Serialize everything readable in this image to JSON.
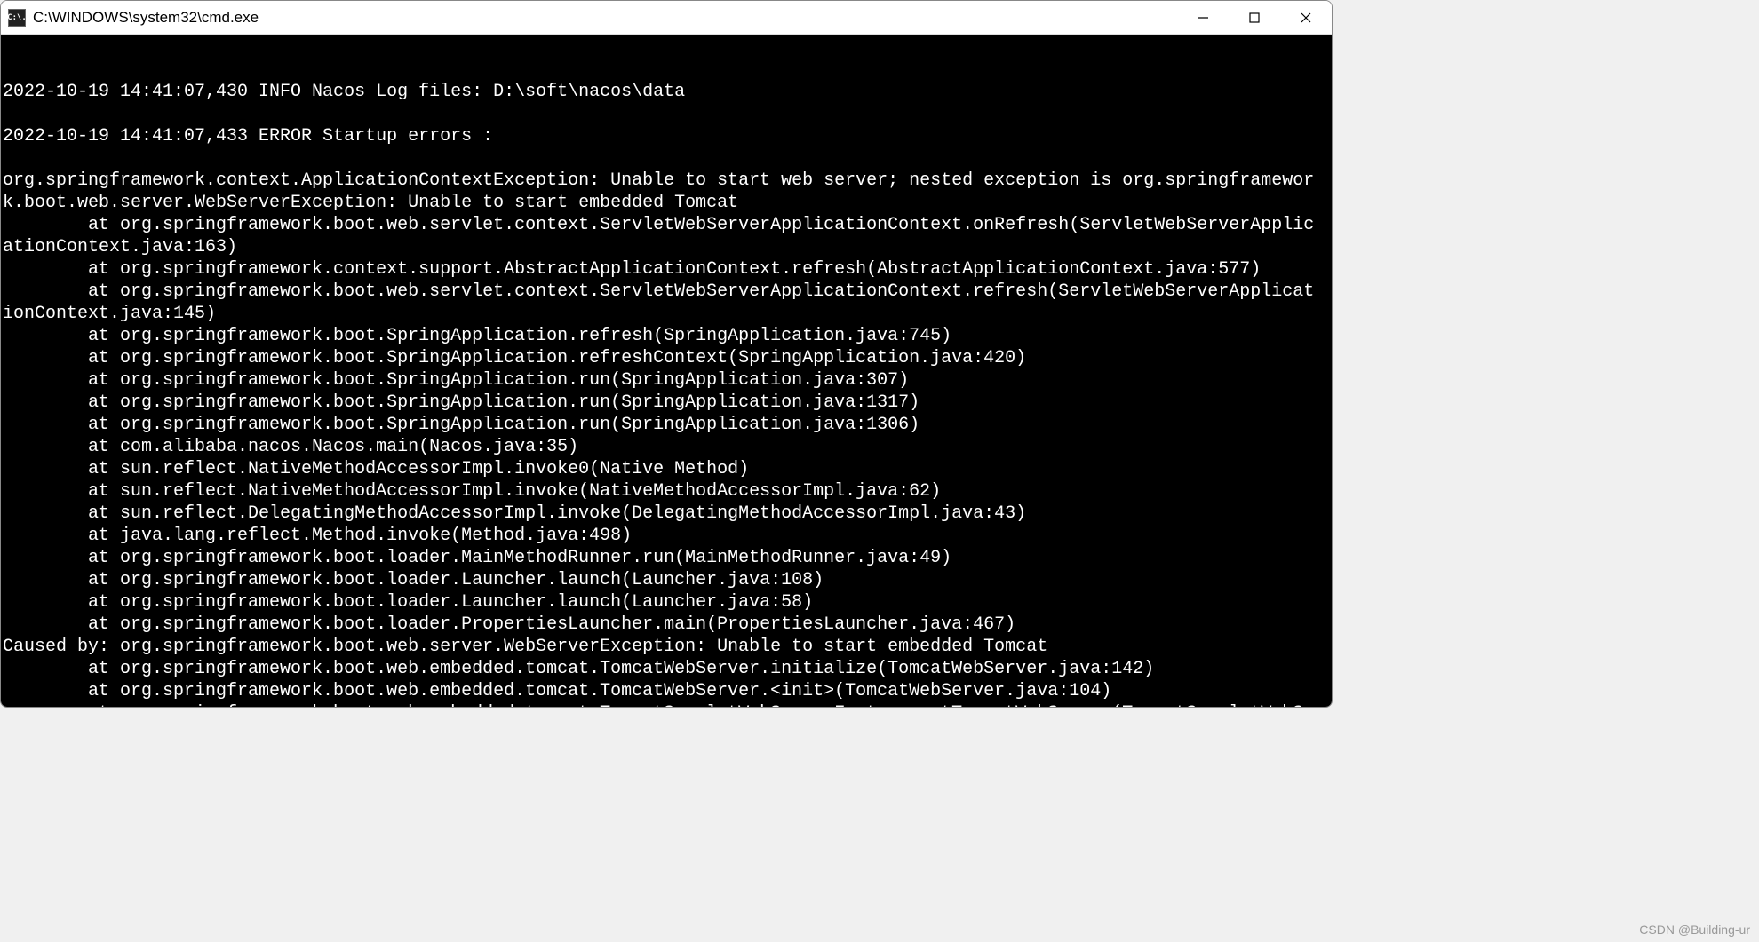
{
  "window": {
    "title": "C:\\WINDOWS\\system32\\cmd.exe",
    "icon_text": "C:\\."
  },
  "terminal": {
    "lines": [
      "2022-10-19 14:41:07,430 INFO Nacos Log files: D:\\soft\\nacos\\data",
      "",
      "2022-10-19 14:41:07,433 ERROR Startup errors :",
      "",
      "org.springframework.context.ApplicationContextException: Unable to start web server; nested exception is org.springframework.boot.web.server.WebServerException: Unable to start embedded Tomcat",
      "        at org.springframework.boot.web.servlet.context.ServletWebServerApplicationContext.onRefresh(ServletWebServerApplicationContext.java:163)",
      "        at org.springframework.context.support.AbstractApplicationContext.refresh(AbstractApplicationContext.java:577)",
      "        at org.springframework.boot.web.servlet.context.ServletWebServerApplicationContext.refresh(ServletWebServerApplicationContext.java:145)",
      "        at org.springframework.boot.SpringApplication.refresh(SpringApplication.java:745)",
      "        at org.springframework.boot.SpringApplication.refreshContext(SpringApplication.java:420)",
      "        at org.springframework.boot.SpringApplication.run(SpringApplication.java:307)",
      "        at org.springframework.boot.SpringApplication.run(SpringApplication.java:1317)",
      "        at org.springframework.boot.SpringApplication.run(SpringApplication.java:1306)",
      "        at com.alibaba.nacos.Nacos.main(Nacos.java:35)",
      "        at sun.reflect.NativeMethodAccessorImpl.invoke0(Native Method)",
      "        at sun.reflect.NativeMethodAccessorImpl.invoke(NativeMethodAccessorImpl.java:62)",
      "        at sun.reflect.DelegatingMethodAccessorImpl.invoke(DelegatingMethodAccessorImpl.java:43)",
      "        at java.lang.reflect.Method.invoke(Method.java:498)",
      "        at org.springframework.boot.loader.MainMethodRunner.run(MainMethodRunner.java:49)",
      "        at org.springframework.boot.loader.Launcher.launch(Launcher.java:108)",
      "        at org.springframework.boot.loader.Launcher.launch(Launcher.java:58)",
      "        at org.springframework.boot.loader.PropertiesLauncher.main(PropertiesLauncher.java:467)",
      "Caused by: org.springframework.boot.web.server.WebServerException: Unable to start embedded Tomcat",
      "        at org.springframework.boot.web.embedded.tomcat.TomcatWebServer.initialize(TomcatWebServer.java:142)",
      "        at org.springframework.boot.web.embedded.tomcat.TomcatWebServer.<init>(TomcatWebServer.java:104)",
      "        at org.springframework.boot.web.embedded.tomcat.TomcatServletWebServerFactory.getTomcatWebServer(TomcatServletWebServerFactory.java:479)"
    ]
  },
  "watermark": "CSDN @Building-ur"
}
